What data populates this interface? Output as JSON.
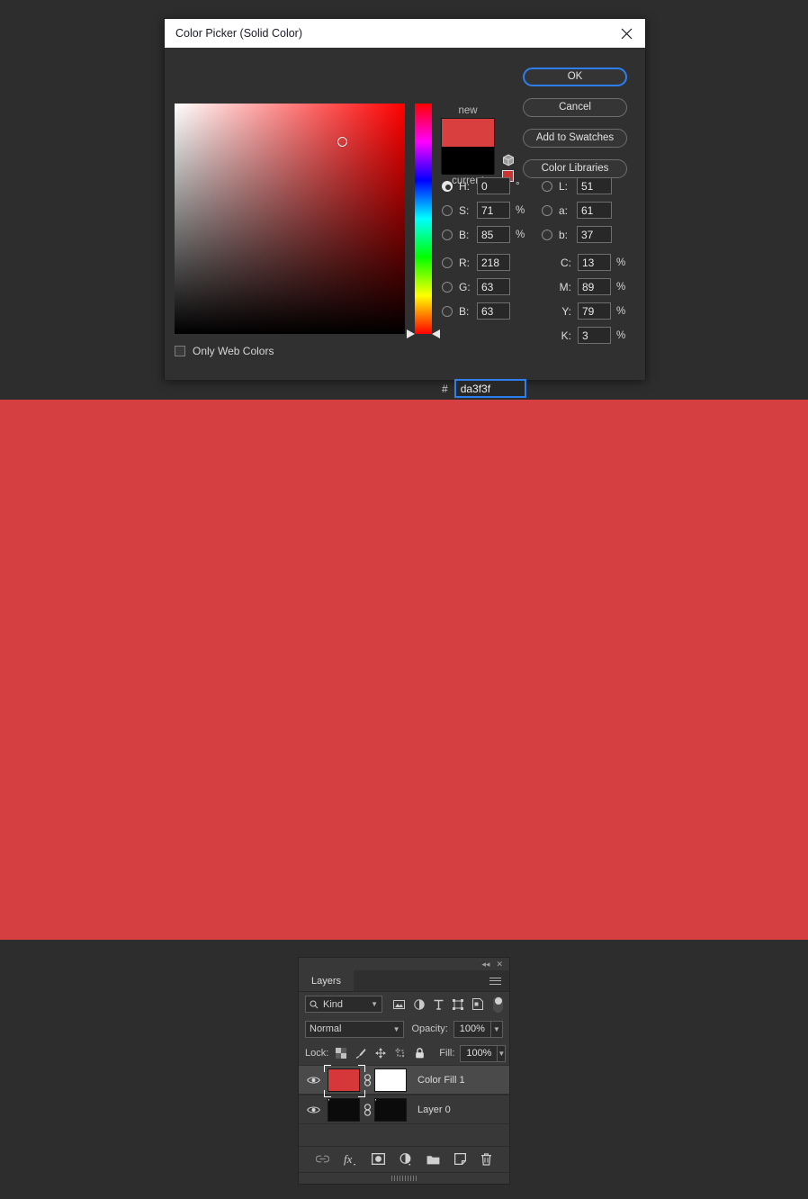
{
  "canvas": {
    "fill_color": "#d63f42"
  },
  "dialog": {
    "title": "Color Picker (Solid Color)",
    "close_icon": "close-icon",
    "web_colors": {
      "label": "Only Web Colors",
      "checked": false
    },
    "swatches": {
      "new_label": "new",
      "current_label": "current",
      "new_color": "#da3f3f",
      "current_color": "#000000",
      "web_safe_swatch_color": "#cc3333",
      "cube_icon": "cube-icon"
    },
    "buttons": {
      "ok": "OK",
      "cancel": "Cancel",
      "add_to_swatches": "Add to Swatches",
      "color_libraries": "Color Libraries"
    },
    "fields": {
      "hsb": [
        {
          "key": "H",
          "label": "H:",
          "value": "0",
          "unit": "°",
          "selected": true
        },
        {
          "key": "S",
          "label": "S:",
          "value": "71",
          "unit": "%",
          "selected": false
        },
        {
          "key": "B",
          "label": "B:",
          "value": "85",
          "unit": "%",
          "selected": false
        }
      ],
      "lab": [
        {
          "key": "L",
          "label": "L:",
          "value": "51",
          "unit": "",
          "selected": false
        },
        {
          "key": "a",
          "label": "a:",
          "value": "61",
          "unit": "",
          "selected": false
        },
        {
          "key": "b",
          "label": "b:",
          "value": "37",
          "unit": "",
          "selected": false
        }
      ],
      "rgb": [
        {
          "key": "R",
          "label": "R:",
          "value": "218",
          "unit": "",
          "selected": false
        },
        {
          "key": "G",
          "label": "G:",
          "value": "63",
          "unit": "",
          "selected": false
        },
        {
          "key": "B",
          "label": "B:",
          "value": "63",
          "unit": "",
          "selected": false
        }
      ],
      "cmyk": [
        {
          "key": "C",
          "label": "C:",
          "value": "13",
          "unit": "%"
        },
        {
          "key": "M",
          "label": "M:",
          "value": "89",
          "unit": "%"
        },
        {
          "key": "Y",
          "label": "Y:",
          "value": "79",
          "unit": "%"
        },
        {
          "key": "K",
          "label": "K:",
          "value": "3",
          "unit": "%"
        }
      ],
      "hex": {
        "sign": "#",
        "value": "da3f3f"
      }
    }
  },
  "layers_panel": {
    "collapse_icon": "collapse-icon",
    "close_icon": "close-icon",
    "tab_label": "Layers",
    "menu_icon": "panel-menu-icon",
    "filter": {
      "kind_label": "Kind",
      "search_icon": "search-icon",
      "icons": [
        "pixel-filter-icon",
        "adjustment-filter-icon",
        "type-filter-icon",
        "shape-filter-icon",
        "smart-object-filter-icon"
      ],
      "toggle": "filter-enable-toggle"
    },
    "blend": {
      "mode": "Normal",
      "opacity_label": "Opacity:",
      "opacity_value": "100%"
    },
    "lock": {
      "label": "Lock:",
      "icons": [
        "lock-transparency-icon",
        "lock-image-icon",
        "lock-position-icon",
        "lock-artboard-icon",
        "lock-all-icon"
      ],
      "fill_label": "Fill:",
      "fill_value": "100%"
    },
    "layers": [
      {
        "name": "Color Fill 1",
        "selected": true,
        "visible": true,
        "thumb": "solid-red",
        "mask_thumb": "white",
        "link_icon": "link-icon"
      },
      {
        "name": "Layer 0",
        "selected": false,
        "visible": true,
        "thumb": "photo",
        "mask_thumb": "photo",
        "link_icon": "link-icon"
      }
    ],
    "bottom_icons": [
      "link-layers-icon",
      "fx-icon",
      "add-mask-icon",
      "new-adjustment-icon",
      "new-group-icon",
      "new-layer-icon",
      "delete-layer-icon"
    ]
  }
}
